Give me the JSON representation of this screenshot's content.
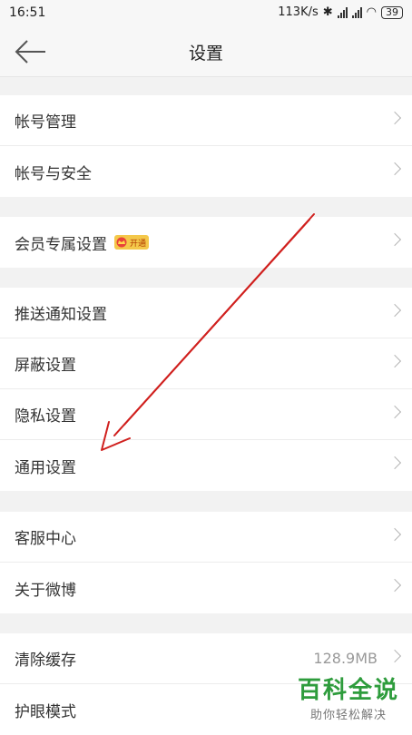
{
  "status": {
    "time": "16:51",
    "speed": "113K/s",
    "battery": "39"
  },
  "nav": {
    "title": "设置",
    "back_icon": "arrow-left-icon"
  },
  "groups": [
    {
      "items": [
        {
          "label": "帐号管理"
        },
        {
          "label": "帐号与安全"
        }
      ]
    },
    {
      "items": [
        {
          "label": "会员专属设置",
          "badge": "开通"
        }
      ]
    },
    {
      "items": [
        {
          "label": "推送通知设置"
        },
        {
          "label": "屏蔽设置"
        },
        {
          "label": "隐私设置"
        },
        {
          "label": "通用设置"
        }
      ]
    },
    {
      "items": [
        {
          "label": "客服中心"
        },
        {
          "label": "关于微博"
        }
      ]
    },
    {
      "items": [
        {
          "label": "清除缓存",
          "value": "128.9MB"
        },
        {
          "label": "护眼模式"
        }
      ]
    }
  ],
  "watermark": {
    "title": "百科全说",
    "subtitle": "助你轻松解决"
  },
  "colors": {
    "annotation_arrow": "#d0201e",
    "watermark_green": "#2e9c3c"
  }
}
